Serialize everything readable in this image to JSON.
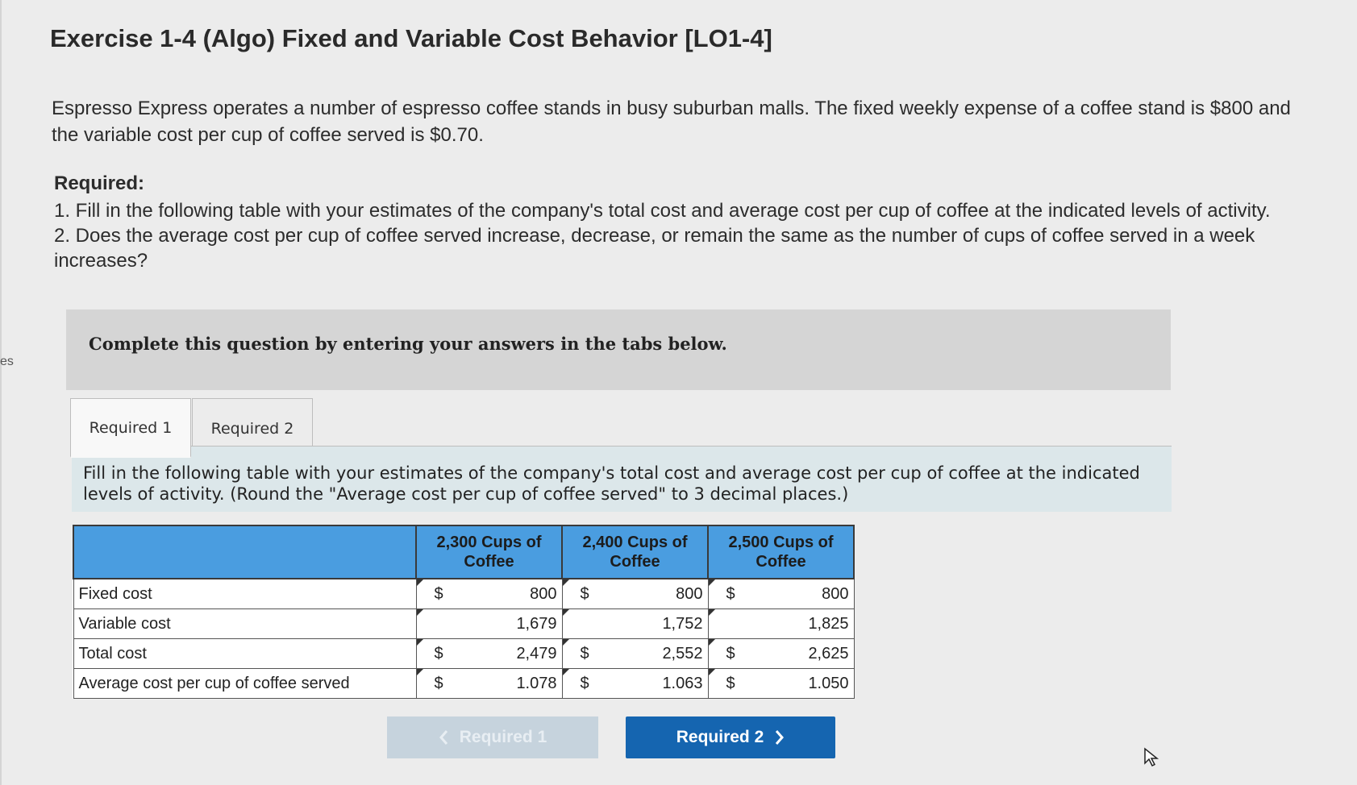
{
  "left_fragment": "es",
  "title": "Exercise 1-4 (Algo) Fixed and Variable Cost Behavior [LO1-4]",
  "intro": "Espresso Express operates a number of espresso coffee stands in busy suburban malls. The fixed weekly expense of a coffee stand is $800 and the variable cost per cup of coffee served is $0.70.",
  "required": {
    "heading": "Required:",
    "items": [
      "1. Fill in the following table with your estimates of the company's total cost and average cost per cup of coffee at the indicated levels of activity.",
      "2. Does the average cost per cup of coffee served increase, decrease, or remain the same as the number of cups of coffee served in a week increases?"
    ]
  },
  "banner": "Complete this question by entering your answers in the tabs below.",
  "tabs": [
    {
      "label": "Required 1",
      "active": true
    },
    {
      "label": "Required 2",
      "active": false
    }
  ],
  "instruction": "Fill in the following table with your estimates of the company's total cost and average cost per cup of coffee at the indicated levels of activity. (Round the \"Average cost per cup of coffee served\" to 3 decimal places.)",
  "table": {
    "columns": [
      "2,300 Cups of Coffee",
      "2,400 Cups of Coffee",
      "2,500 Cups of Coffee"
    ],
    "rows": [
      {
        "label": "Fixed cost",
        "cells": [
          {
            "dollar": "$",
            "value": "800"
          },
          {
            "dollar": "$",
            "value": "800"
          },
          {
            "dollar": "$",
            "value": "800"
          }
        ]
      },
      {
        "label": "Variable cost",
        "cells": [
          {
            "dollar": "",
            "value": "1,679"
          },
          {
            "dollar": "",
            "value": "1,752"
          },
          {
            "dollar": "",
            "value": "1,825"
          }
        ]
      },
      {
        "label": "Total cost",
        "cells": [
          {
            "dollar": "$",
            "value": "2,479"
          },
          {
            "dollar": "$",
            "value": "2,552"
          },
          {
            "dollar": "$",
            "value": "2,625"
          }
        ]
      },
      {
        "label": "Average cost per cup of coffee served",
        "cells": [
          {
            "dollar": "$",
            "value": "1.078"
          },
          {
            "dollar": "$",
            "value": "1.063"
          },
          {
            "dollar": "$",
            "value": "1.050"
          }
        ]
      }
    ]
  },
  "nav": {
    "prev_label": "Required 1",
    "next_label": "Required 2",
    "prev_icon": "chevron-left-icon",
    "next_icon": "chevron-right-icon"
  },
  "colors": {
    "header_blue": "#4a9de0",
    "next_button": "#1565b0",
    "instruction_bg": "#dce7ea"
  }
}
